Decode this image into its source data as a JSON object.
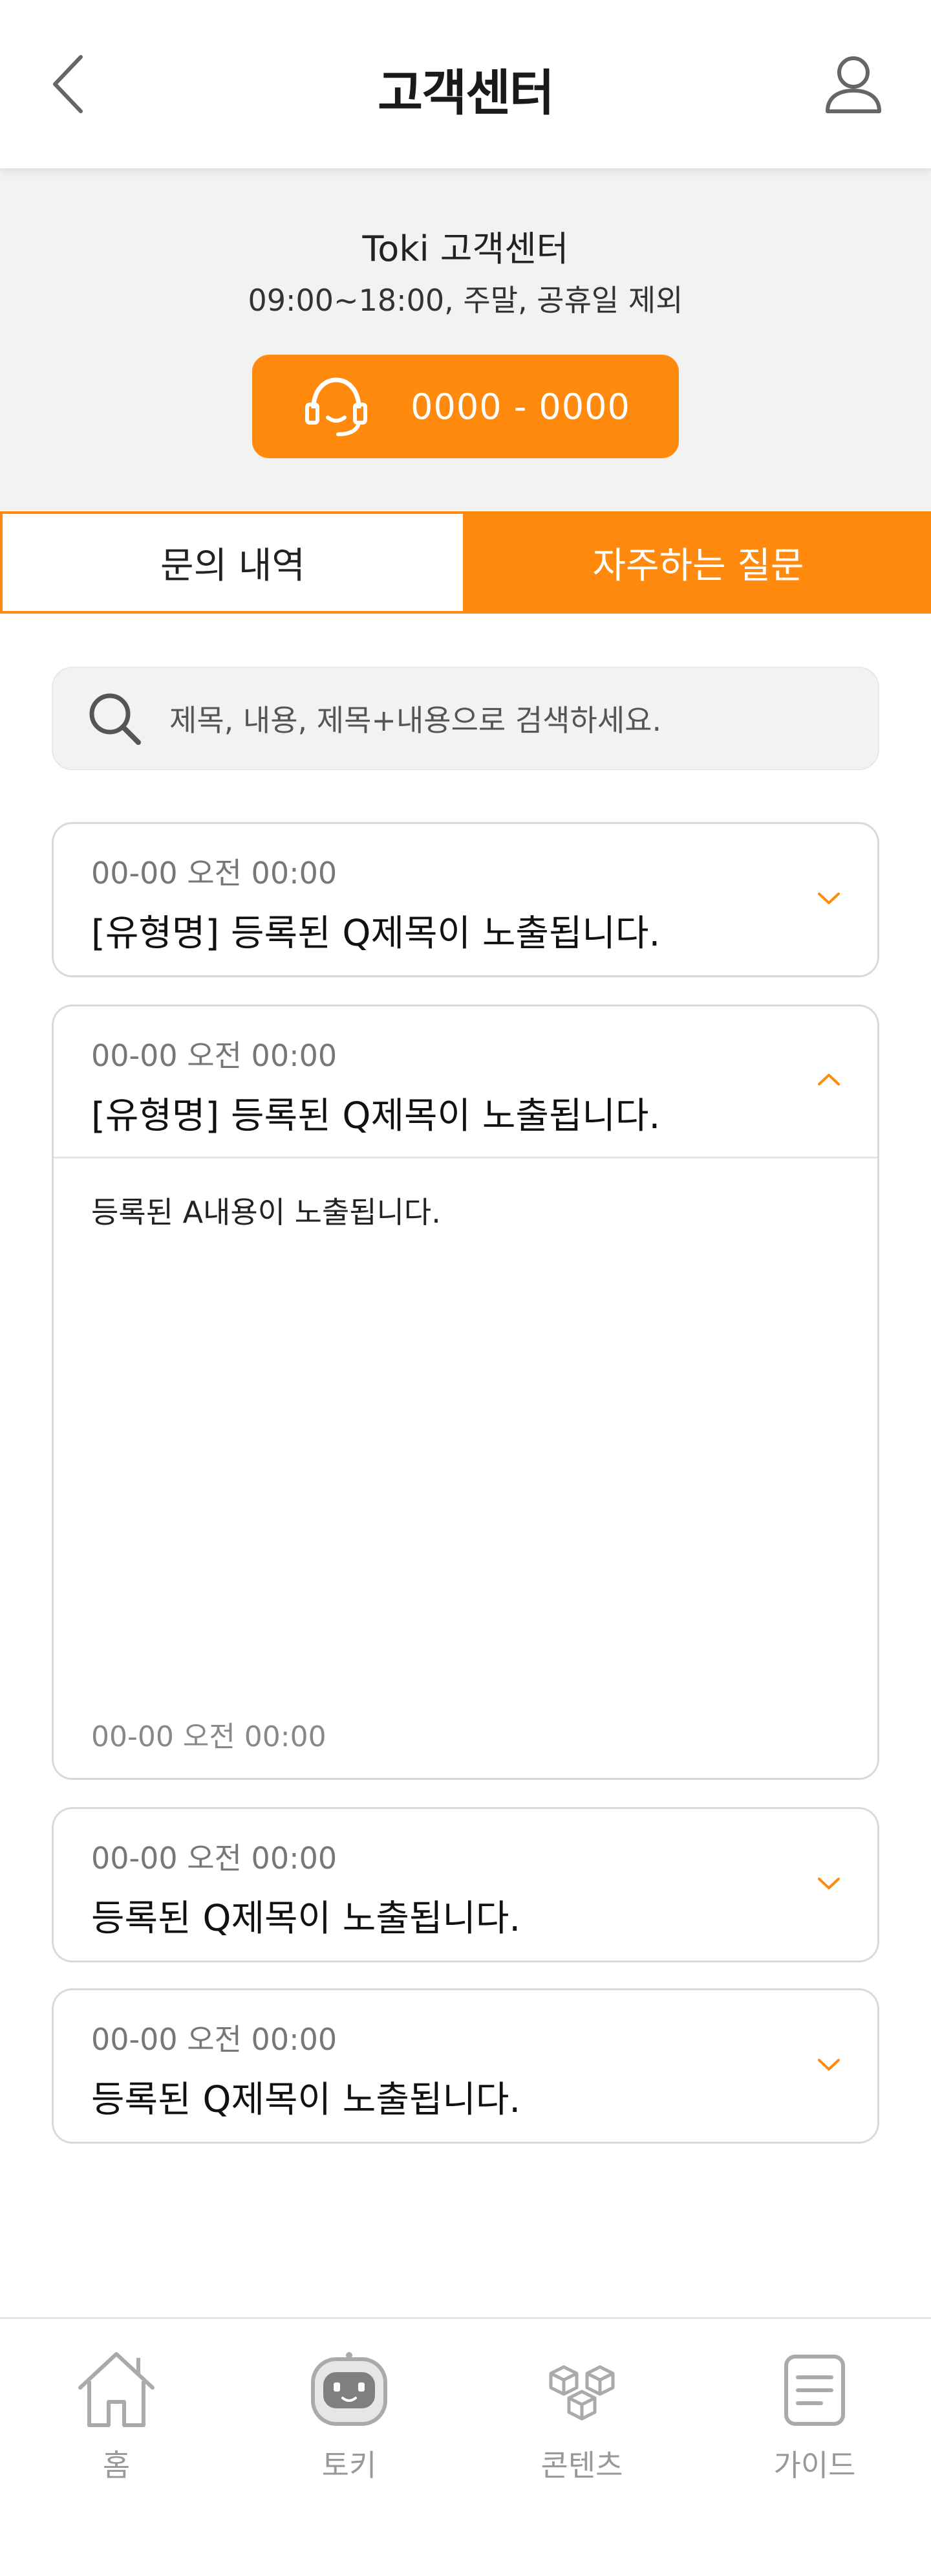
{
  "header": {
    "title": "고객센터"
  },
  "banner": {
    "center_name": "Toki 고객센터",
    "hours": "09:00~18:00, 주말, 공휴일 제외",
    "phone": "0000 - 0000"
  },
  "tabs": [
    {
      "label": "문의 내역",
      "active": false
    },
    {
      "label": "자주하는 질문",
      "active": true
    }
  ],
  "search": {
    "placeholder": "제목, 내용, 제목+내용으로 검색하세요."
  },
  "faq": [
    {
      "date": "00-00 오전 00:00",
      "question": "[유형명] 등록된 Q제목이 노출됩니다.",
      "expanded": false
    },
    {
      "date": "00-00 오전 00:00",
      "question": "[유형명] 등록된 Q제목이 노출됩니다.",
      "expanded": true,
      "answer": "등록된 A내용이 노출됩니다.",
      "answer_date": "00-00 오전 00:00"
    },
    {
      "date": "00-00 오전 00:00",
      "question": "등록된 Q제목이 노출됩니다.",
      "expanded": false
    },
    {
      "date": "00-00 오전 00:00",
      "question": "등록된 Q제목이 노출됩니다.",
      "expanded": false
    }
  ],
  "bottom_nav": [
    {
      "label": "홈",
      "icon": "home-icon"
    },
    {
      "label": "토키",
      "icon": "toki-robot-icon"
    },
    {
      "label": "콘텐츠",
      "icon": "cubes-icon"
    },
    {
      "label": "가이드",
      "icon": "document-icon"
    }
  ],
  "colors": {
    "accent": "#ff8a0d",
    "banner_bg": "#f2f2f2",
    "muted_text": "#999999"
  }
}
